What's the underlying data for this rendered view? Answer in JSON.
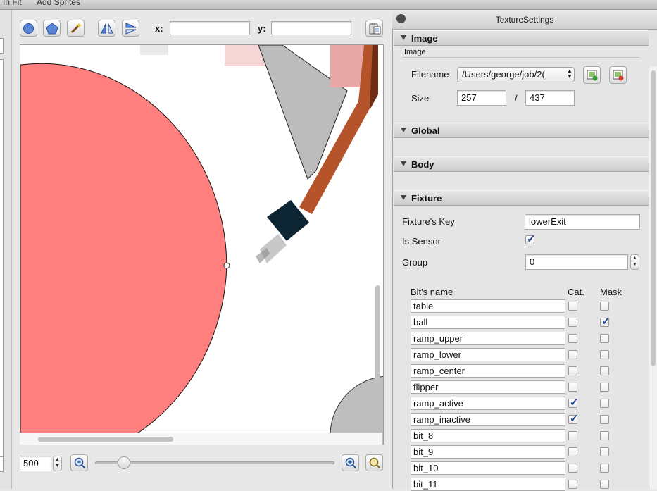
{
  "top_strip": {
    "left_fragment": "In Fit",
    "sprites_label": "Add Sprites"
  },
  "toolbar": {
    "circle_tool": "circle-icon",
    "polygon_tool": "pentagon-icon",
    "magic_wand_tool": "magic-wand-icon",
    "flip_horizontal_tool": "flip-horizontal-icon",
    "flip_vertical_tool": "flip-vertical-icon",
    "x_label": "x:",
    "x_value": "",
    "y_label": "y:",
    "y_value": "",
    "clipboard_tool": "clipboard-icon"
  },
  "zoom": {
    "value": "500",
    "zoom_out_icon": "zoom-out-icon",
    "zoom_in_icon": "zoom-in-icon",
    "zoom_fit_icon": "zoom-fit-icon",
    "slider_level": 0.1
  },
  "panel": {
    "title": "TextureSettings",
    "sections": {
      "image": "Image",
      "global": "Global",
      "body": "Body",
      "fixture": "Fixture"
    },
    "image": {
      "group_label": "Image",
      "filename_label": "Filename",
      "filename_value": "/Users/george/job/2(",
      "size_label": "Size",
      "width": "257",
      "separator": "/",
      "height": "437"
    },
    "fixture": {
      "key_label": "Fixture's Key",
      "key_value": "lowerExit",
      "sensor_label": "Is Sensor",
      "is_sensor": true,
      "group_label": "Group",
      "group_value": "0",
      "bits_header": "Bit's name",
      "cat_header": "Cat.",
      "mask_header": "Mask",
      "bits": [
        {
          "name": "table",
          "cat": false,
          "mask": false
        },
        {
          "name": "ball",
          "cat": false,
          "mask": true
        },
        {
          "name": "ramp_upper",
          "cat": false,
          "mask": false
        },
        {
          "name": "ramp_lower",
          "cat": false,
          "mask": false
        },
        {
          "name": "ramp_center",
          "cat": false,
          "mask": false
        },
        {
          "name": "flipper",
          "cat": false,
          "mask": false
        },
        {
          "name": "ramp_active",
          "cat": true,
          "mask": false
        },
        {
          "name": "ramp_inactive",
          "cat": true,
          "mask": false
        },
        {
          "name": "bit_8",
          "cat": false,
          "mask": false
        },
        {
          "name": "bit_9",
          "cat": false,
          "mask": false
        },
        {
          "name": "bit_10",
          "cat": false,
          "mask": false
        },
        {
          "name": "bit_11",
          "cat": false,
          "mask": false
        }
      ]
    }
  },
  "colors": {
    "circle_fill": "#ff7f7f",
    "rod": "#b5532a",
    "knob": "#0e2533",
    "check": "#1b3f8f"
  }
}
